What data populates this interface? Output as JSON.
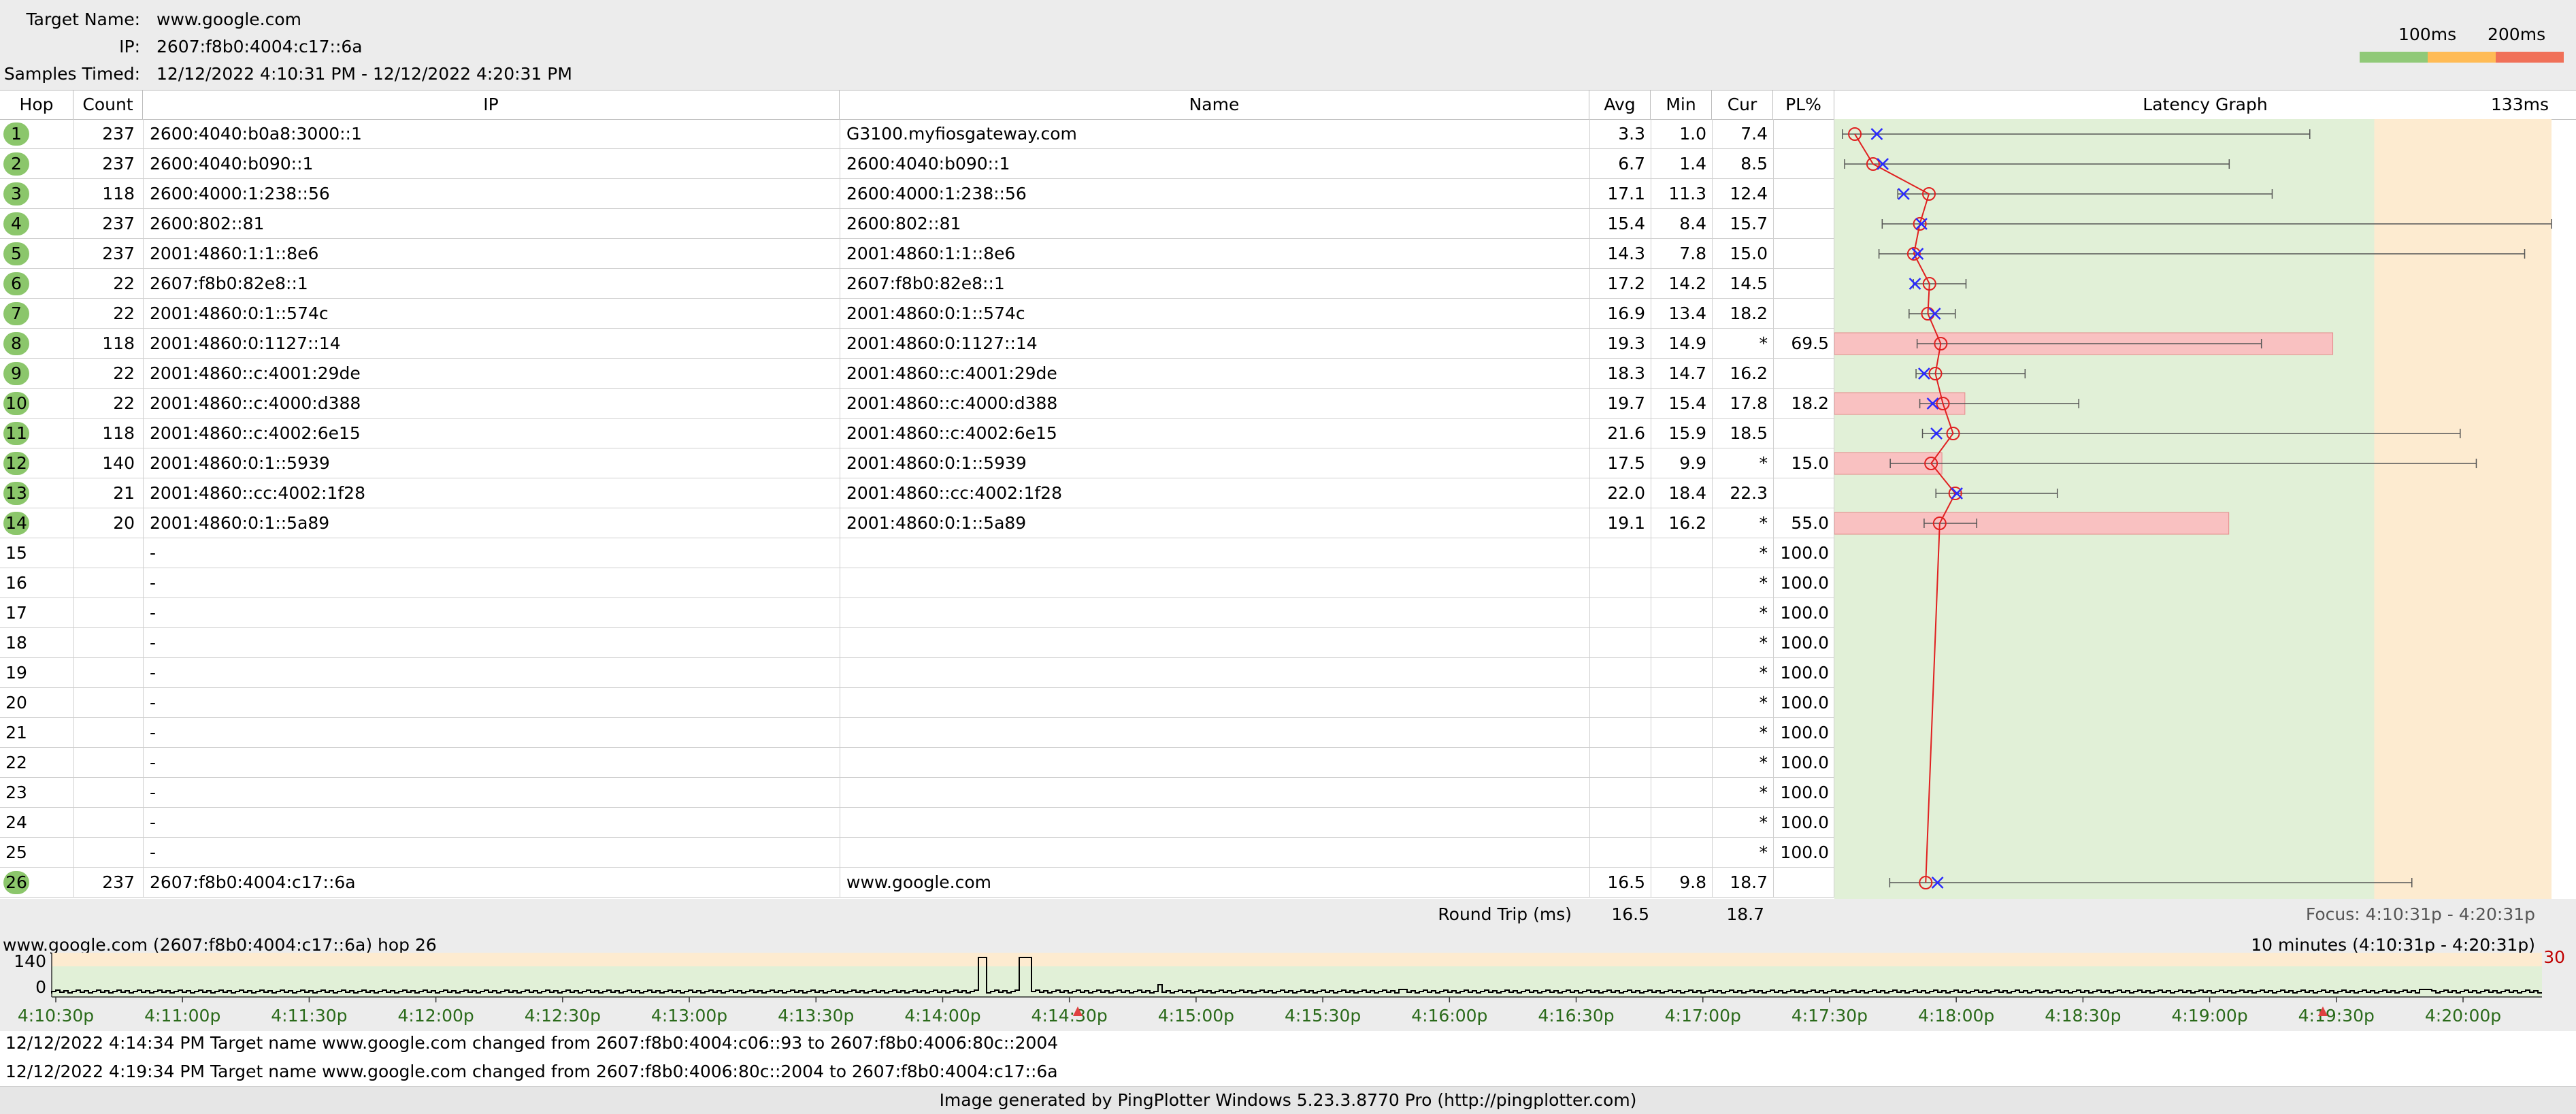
{
  "header": {
    "target_name_label": "Target Name:",
    "target_name": "www.google.com",
    "ip_label": "IP:",
    "ip": "2607:f8b0:4004:c17::6a",
    "samples_label": "Samples Timed:",
    "samples": "12/12/2022 4:10:31 PM - 12/12/2022 4:20:31 PM",
    "scale_100": "100ms",
    "scale_200": "200ms",
    "colors": {
      "good": "#90c978",
      "warn": "#ffbb55",
      "bad": "#f07058"
    }
  },
  "columns": {
    "hop": "Hop",
    "count": "Count",
    "ip": "IP",
    "name": "Name",
    "avg": "Avg",
    "min": "Min",
    "cur": "Cur",
    "pl": "PL%",
    "graph": "Latency Graph",
    "graph_max": "133ms"
  },
  "hops": [
    {
      "hop": "1",
      "count": "237",
      "ip": "2600:4040:b0a8:3000::1",
      "name": "G3100.myfiosgateway.com",
      "avg": "3.3",
      "min": "1.0",
      "cur": "7.4",
      "pl": "",
      "green": true,
      "min_ms": 1.0,
      "avg_ms": 3.3,
      "cur_ms": 7.4,
      "max_ms": 88,
      "loss": 0
    },
    {
      "hop": "2",
      "count": "237",
      "ip": "2600:4040:b090::1",
      "name": "2600:4040:b090::1",
      "avg": "6.7",
      "min": "1.4",
      "cur": "8.5",
      "pl": "",
      "green": true,
      "min_ms": 1.4,
      "avg_ms": 6.7,
      "cur_ms": 8.5,
      "max_ms": 73,
      "loss": 0
    },
    {
      "hop": "3",
      "count": "118",
      "ip": "2600:4000:1:238::56",
      "name": "2600:4000:1:238::56",
      "avg": "17.1",
      "min": "11.3",
      "cur": "12.4",
      "pl": "",
      "green": true,
      "min_ms": 11.3,
      "avg_ms": 17.1,
      "cur_ms": 12.4,
      "max_ms": 81,
      "loss": 0
    },
    {
      "hop": "4",
      "count": "237",
      "ip": "2600:802::81",
      "name": "2600:802::81",
      "avg": "15.4",
      "min": "8.4",
      "cur": "15.7",
      "pl": "",
      "green": true,
      "min_ms": 8.4,
      "avg_ms": 15.4,
      "cur_ms": 15.7,
      "max_ms": 133,
      "loss": 0
    },
    {
      "hop": "5",
      "count": "237",
      "ip": "2001:4860:1:1::8e6",
      "name": "2001:4860:1:1::8e6",
      "avg": "14.3",
      "min": "7.8",
      "cur": "15.0",
      "pl": "",
      "green": true,
      "min_ms": 7.8,
      "avg_ms": 14.3,
      "cur_ms": 15.0,
      "max_ms": 128,
      "loss": 0
    },
    {
      "hop": "6",
      "count": "22",
      "ip": "2607:f8b0:82e8::1",
      "name": "2607:f8b0:82e8::1",
      "avg": "17.2",
      "min": "14.2",
      "cur": "14.5",
      "pl": "",
      "green": true,
      "min_ms": 14.2,
      "avg_ms": 17.2,
      "cur_ms": 14.5,
      "max_ms": 24,
      "loss": 0
    },
    {
      "hop": "7",
      "count": "22",
      "ip": "2001:4860:0:1::574c",
      "name": "2001:4860:0:1::574c",
      "avg": "16.9",
      "min": "13.4",
      "cur": "18.2",
      "pl": "",
      "green": true,
      "min_ms": 13.4,
      "avg_ms": 16.9,
      "cur_ms": 18.2,
      "max_ms": 22,
      "loss": 0
    },
    {
      "hop": "8",
      "count": "118",
      "ip": "2001:4860:0:1127::14",
      "name": "2001:4860:0:1127::14",
      "avg": "19.3",
      "min": "14.9",
      "cur": "*",
      "pl": "69.5",
      "green": true,
      "min_ms": 14.9,
      "avg_ms": 19.3,
      "cur_ms": null,
      "max_ms": 79,
      "loss": 69.5
    },
    {
      "hop": "9",
      "count": "22",
      "ip": "2001:4860::c:4001:29de",
      "name": "2001:4860::c:4001:29de",
      "avg": "18.3",
      "min": "14.7",
      "cur": "16.2",
      "pl": "",
      "green": true,
      "min_ms": 14.7,
      "avg_ms": 18.3,
      "cur_ms": 16.2,
      "max_ms": 35,
      "loss": 0
    },
    {
      "hop": "10",
      "count": "22",
      "ip": "2001:4860::c:4000:d388",
      "name": "2001:4860::c:4000:d388",
      "avg": "19.7",
      "min": "15.4",
      "cur": "17.8",
      "pl": "18.2",
      "green": true,
      "min_ms": 15.4,
      "avg_ms": 19.7,
      "cur_ms": 17.8,
      "max_ms": 45,
      "loss": 18.2
    },
    {
      "hop": "11",
      "count": "118",
      "ip": "2001:4860::c:4002:6e15",
      "name": "2001:4860::c:4002:6e15",
      "avg": "21.6",
      "min": "15.9",
      "cur": "18.5",
      "pl": "",
      "green": true,
      "min_ms": 15.9,
      "avg_ms": 21.6,
      "cur_ms": 18.5,
      "max_ms": 116,
      "loss": 0
    },
    {
      "hop": "12",
      "count": "140",
      "ip": "2001:4860:0:1::5939",
      "name": "2001:4860:0:1::5939",
      "avg": "17.5",
      "min": "9.9",
      "cur": "*",
      "pl": "15.0",
      "green": true,
      "min_ms": 9.9,
      "avg_ms": 17.5,
      "cur_ms": null,
      "max_ms": 119,
      "loss": 15.0
    },
    {
      "hop": "13",
      "count": "21",
      "ip": "2001:4860::cc:4002:1f28",
      "name": "2001:4860::cc:4002:1f28",
      "avg": "22.0",
      "min": "18.4",
      "cur": "22.3",
      "pl": "",
      "green": true,
      "min_ms": 18.4,
      "avg_ms": 22.0,
      "cur_ms": 22.3,
      "max_ms": 41,
      "loss": 0
    },
    {
      "hop": "14",
      "count": "20",
      "ip": "2001:4860:0:1::5a89",
      "name": "2001:4860:0:1::5a89",
      "avg": "19.1",
      "min": "16.2",
      "cur": "*",
      "pl": "55.0",
      "green": true,
      "min_ms": 16.2,
      "avg_ms": 19.1,
      "cur_ms": null,
      "max_ms": 26,
      "loss": 55.0
    },
    {
      "hop": "15",
      "count": "",
      "ip": "-",
      "name": "",
      "avg": "",
      "min": "",
      "cur": "*",
      "pl": "100.0",
      "green": false
    },
    {
      "hop": "16",
      "count": "",
      "ip": "-",
      "name": "",
      "avg": "",
      "min": "",
      "cur": "*",
      "pl": "100.0",
      "green": false
    },
    {
      "hop": "17",
      "count": "",
      "ip": "-",
      "name": "",
      "avg": "",
      "min": "",
      "cur": "*",
      "pl": "100.0",
      "green": false
    },
    {
      "hop": "18",
      "count": "",
      "ip": "-",
      "name": "",
      "avg": "",
      "min": "",
      "cur": "*",
      "pl": "100.0",
      "green": false
    },
    {
      "hop": "19",
      "count": "",
      "ip": "-",
      "name": "",
      "avg": "",
      "min": "",
      "cur": "*",
      "pl": "100.0",
      "green": false
    },
    {
      "hop": "20",
      "count": "",
      "ip": "-",
      "name": "",
      "avg": "",
      "min": "",
      "cur": "*",
      "pl": "100.0",
      "green": false
    },
    {
      "hop": "21",
      "count": "",
      "ip": "-",
      "name": "",
      "avg": "",
      "min": "",
      "cur": "*",
      "pl": "100.0",
      "green": false
    },
    {
      "hop": "22",
      "count": "",
      "ip": "-",
      "name": "",
      "avg": "",
      "min": "",
      "cur": "*",
      "pl": "100.0",
      "green": false
    },
    {
      "hop": "23",
      "count": "",
      "ip": "-",
      "name": "",
      "avg": "",
      "min": "",
      "cur": "*",
      "pl": "100.0",
      "green": false
    },
    {
      "hop": "24",
      "count": "",
      "ip": "-",
      "name": "",
      "avg": "",
      "min": "",
      "cur": "*",
      "pl": "100.0",
      "green": false
    },
    {
      "hop": "25",
      "count": "",
      "ip": "-",
      "name": "",
      "avg": "",
      "min": "",
      "cur": "*",
      "pl": "100.0",
      "green": false
    },
    {
      "hop": "26",
      "count": "237",
      "ip": "2607:f8b0:4004:c17::6a",
      "name": "www.google.com",
      "avg": "16.5",
      "min": "9.8",
      "cur": "18.7",
      "pl": "",
      "green": true,
      "min_ms": 9.8,
      "avg_ms": 16.5,
      "cur_ms": 18.7,
      "max_ms": 107,
      "loss": 0
    }
  ],
  "round_trip": {
    "label": "Round Trip (ms)",
    "avg": "16.5",
    "cur": "18.7",
    "focus": "Focus: 4:10:31p - 4:20:31p"
  },
  "timeline": {
    "title": "www.google.com (2607:f8b0:4004:c17::6a) hop 26",
    "range": "10 minutes (4:10:31p - 4:20:31p)",
    "y_max": "140",
    "y_min": "0",
    "right_val": "30",
    "ticks": [
      "4:10:30p",
      "4:11:00p",
      "4:11:30p",
      "4:12:00p",
      "4:12:30p",
      "4:13:00p",
      "4:13:30p",
      "4:14:00p",
      "4:14:30p",
      "4:15:00p",
      "4:15:30p",
      "4:16:00p",
      "4:16:30p",
      "4:17:00p",
      "4:17:30p",
      "4:18:00p",
      "4:18:30p",
      "4:19:00p",
      "4:19:30p",
      "4:20:00p"
    ]
  },
  "events": [
    "12/12/2022 4:14:34 PM Target name www.google.com changed from 2607:f8b0:4004:c06::93 to 2607:f8b0:4006:80c::2004",
    "12/12/2022 4:19:34 PM Target name www.google.com changed from 2607:f8b0:4006:80c::2004 to 2607:f8b0:4004:c17::6a"
  ],
  "footer": "Image generated by PingPlotter Windows 5.23.3.8770 Pro (http://pingplotter.com)"
}
